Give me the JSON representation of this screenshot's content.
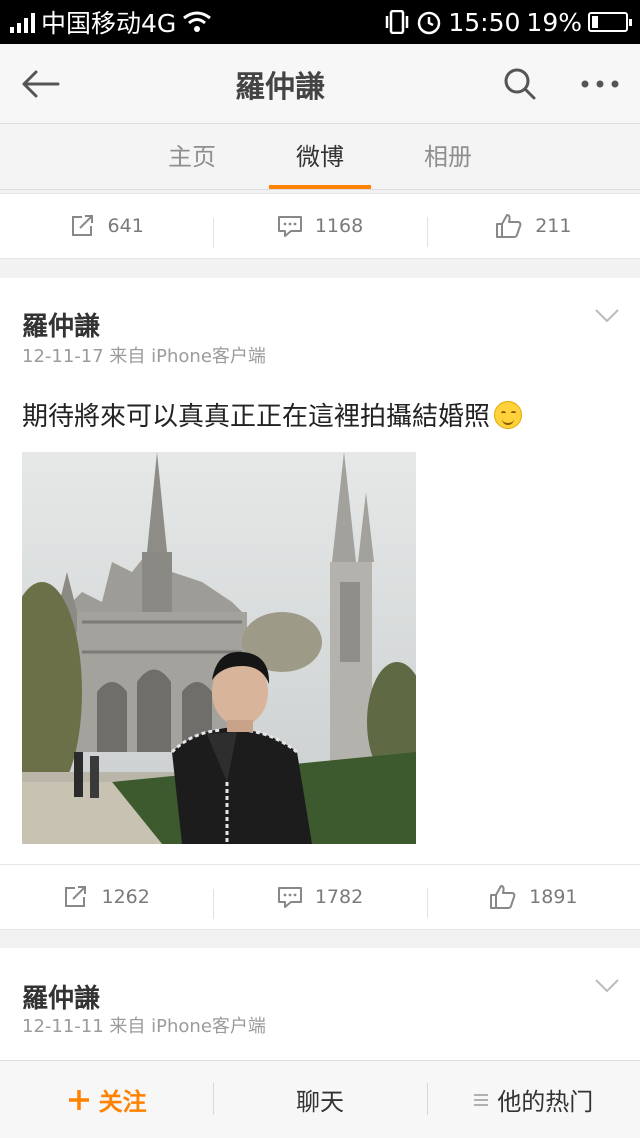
{
  "status_bar": {
    "carrier": "中国移动4G",
    "time": "15:50",
    "battery": "19%",
    "battery_level": 0.19
  },
  "header": {
    "title": "羅仲謙"
  },
  "tabs": [
    {
      "label": "主页",
      "active": false
    },
    {
      "label": "微博",
      "active": true
    },
    {
      "label": "相册",
      "active": false
    }
  ],
  "posts": [
    {
      "actions": {
        "repost": "641",
        "comment": "1168",
        "like": "211"
      }
    },
    {
      "author": "羅仲謙",
      "meta": "12-11-17  来自 iPhone客户端",
      "text": "期待將來可以真真正正在這裡拍攝結婚照",
      "actions": {
        "repost": "1262",
        "comment": "1782",
        "like": "1891"
      }
    },
    {
      "author": "羅仲謙",
      "meta": "12-11-11  来自 iPhone客户端"
    }
  ],
  "bottom_bar": {
    "follow": "关注",
    "chat": "聊天",
    "hot": "他的热门"
  },
  "colors": {
    "accent": "#ff8200"
  }
}
